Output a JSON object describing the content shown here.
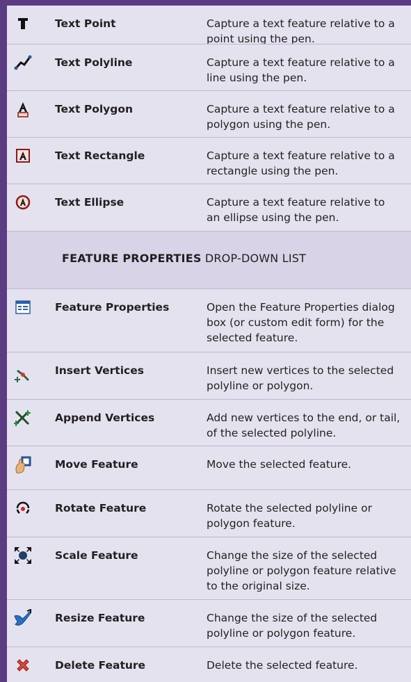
{
  "text_tools": [
    {
      "name": "Text Point",
      "icon": "text-point-icon",
      "desc": [
        "Capture a text feature relative to a",
        "point using the pen."
      ]
    },
    {
      "name": "Text Polyline",
      "icon": "text-polyline-icon",
      "desc": [
        "Capture a text feature relative to a",
        "line using the pen."
      ]
    },
    {
      "name": "Text Polygon",
      "icon": "text-polygon-icon",
      "desc": [
        "Capture a text feature relative to a",
        "polygon using the pen."
      ]
    },
    {
      "name": "Text Rectangle",
      "icon": "text-rectangle-icon",
      "desc": [
        "Capture a text feature relative to a",
        "rectangle using the pen."
      ]
    },
    {
      "name": "Text Ellipse",
      "icon": "text-ellipse-icon",
      "desc": [
        "Capture a text feature relative to",
        "an ellipse using the pen."
      ]
    }
  ],
  "section_header": {
    "bold": "FEATURE PROPERTIES",
    "rest": " DROP-DOWN LIST"
  },
  "feature_tools": [
    {
      "name": "Feature Properties",
      "icon": "feature-properties-icon",
      "desc": [
        "Open the Feature Properties dialog",
        "box (or custom edit form) for the",
        "selected feature."
      ]
    },
    {
      "name": "Insert Vertices",
      "icon": "insert-vertices-icon",
      "desc": [
        "Insert new vertices to the selected",
        "polyline or polygon."
      ]
    },
    {
      "name": "Append Vertices",
      "icon": "append-vertices-icon",
      "desc": [
        "Add new vertices to the end, or tail,",
        "of the selected polyline."
      ]
    },
    {
      "name": "Move Feature",
      "icon": "move-feature-icon",
      "desc": [
        "Move the selected feature."
      ]
    },
    {
      "name": "Rotate Feature",
      "icon": "rotate-feature-icon",
      "desc": [
        "Rotate the selected polyline or",
        "polygon feature."
      ]
    },
    {
      "name": "Scale Feature",
      "icon": "scale-feature-icon",
      "desc": [
        "Change the size of the selected",
        "polyline or polygon feature relative",
        "to the original size."
      ]
    },
    {
      "name": "Resize Feature",
      "icon": "resize-feature-icon",
      "desc": [
        "Change the size of the selected",
        "polyline or polygon feature."
      ]
    },
    {
      "name": "Delete Feature",
      "icon": "delete-feature-icon",
      "desc": [
        "Delete the selected feature."
      ]
    }
  ],
  "colors": {
    "sidebar": "#5b3b82",
    "row_bg": "#e5e2ef",
    "rule": "#bdb7d2"
  }
}
